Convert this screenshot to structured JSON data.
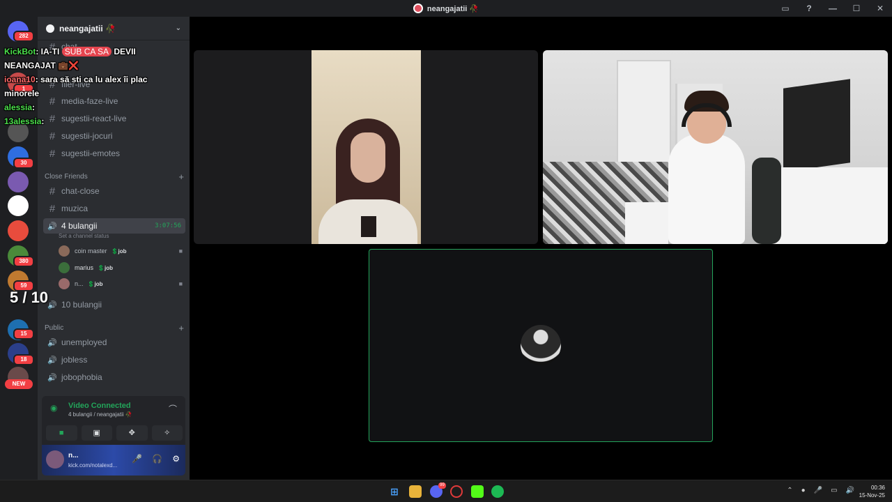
{
  "window": {
    "title": "neangajatii 🥀"
  },
  "guilds": [
    {
      "name": "discord-home",
      "badge": "282"
    },
    {
      "name": "server-2",
      "badge": "1"
    },
    {
      "name": "server-3",
      "badge": ""
    },
    {
      "name": "server-4",
      "badge": "30"
    },
    {
      "name": "server-5",
      "badge": ""
    },
    {
      "name": "server-6",
      "badge": ""
    },
    {
      "name": "server-7",
      "badge": ""
    },
    {
      "name": "server-8",
      "badge": "380"
    },
    {
      "name": "server-9",
      "badge": "59"
    },
    {
      "name": "server-10",
      "badge": ""
    },
    {
      "name": "server-11",
      "badge": "15"
    },
    {
      "name": "server-12",
      "badge": "18"
    }
  ],
  "guild_new_label": "NEW",
  "server": {
    "name": "neangajatii 🥀"
  },
  "channels_top": [
    {
      "label": "chat"
    },
    {
      "label": "filer-live"
    },
    {
      "label": "media-faze-live"
    },
    {
      "label": "sugestii-react-live"
    },
    {
      "label": "sugestii-jocuri"
    },
    {
      "label": "sugestii-emotes"
    }
  ],
  "category_close": "Close Friends",
  "channels_close": [
    {
      "label": "chat-close"
    },
    {
      "label": "muzica"
    }
  ],
  "voice_active": {
    "label": "4 bulangii",
    "timer": "3:07:56",
    "status": "Set a channel status"
  },
  "voice_users": [
    {
      "name": "coin master",
      "tag": "💲job"
    },
    {
      "name": "marius",
      "tag": "💲job"
    },
    {
      "name": "n...",
      "tag": "💲job"
    }
  ],
  "voice_other": {
    "label": "10 bulangii"
  },
  "category_public": "Public",
  "channels_public": [
    {
      "label": "unemployed"
    },
    {
      "label": "jobless"
    },
    {
      "label": "jobophobia"
    }
  ],
  "voice_panel": {
    "title": "Video Connected",
    "subtitle": "4 bulangii / neangajatii 🥀"
  },
  "user_panel": {
    "name": "n...",
    "status": "kick.com/notalexd..."
  },
  "overlay": {
    "line1_name": "KickBot",
    "line1_text": ": IA-TI",
    "line1_pill": "SUB CA SA",
    "line1_tail": "DEVII",
    "line2": "NEANGAJAT 💼❌",
    "line3_name": "ioana10",
    "line3_text": ": sara să sti ca lu alex îi plac",
    "line4": "minorele",
    "line5_name": "alessia",
    "line5_text": ":",
    "line6_name": "13alessia",
    "line6_text": ":"
  },
  "score": "5 / 10",
  "taskbar": {
    "time": "00:36",
    "date": "15-Nov-25",
    "discord_badge": "99"
  },
  "colors": {
    "accent_green": "#23a55a",
    "danger": "#f23f43",
    "bg": "#000000"
  }
}
